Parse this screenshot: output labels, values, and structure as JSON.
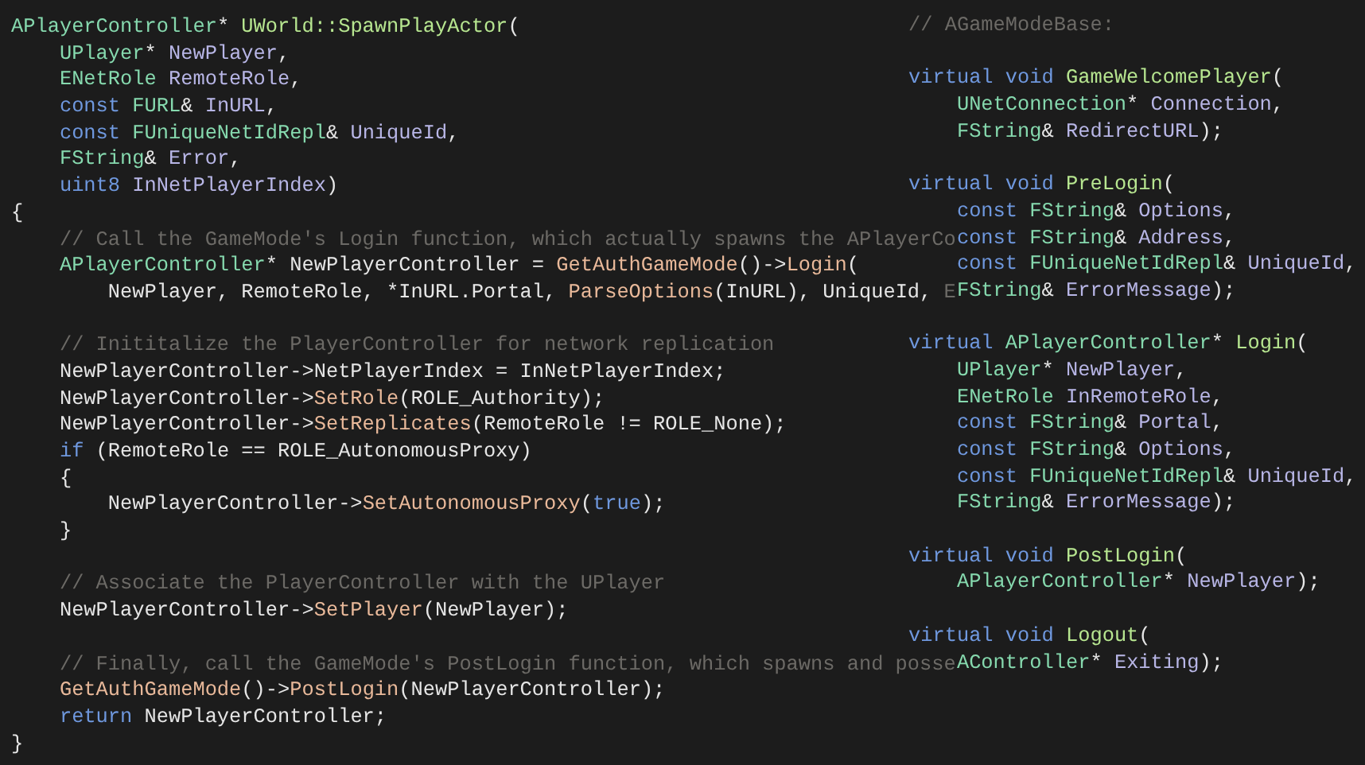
{
  "main_code": {
    "blocks": [
      {
        "lines": [
          [
            {
              "kind": "type",
              "text": "APlayerController"
            },
            {
              "kind": "plain",
              "text": "* "
            },
            {
              "kind": "func",
              "text": "UWorld::SpawnPlayActor"
            },
            {
              "kind": "plain",
              "text": "("
            }
          ],
          [
            {
              "kind": "type",
              "text": "    UPlayer"
            },
            {
              "kind": "plain",
              "text": "* "
            },
            {
              "kind": "param",
              "text": "NewPlayer"
            },
            {
              "kind": "plain",
              "text": ","
            }
          ],
          [
            {
              "kind": "type",
              "text": "    ENetRole "
            },
            {
              "kind": "param",
              "text": "RemoteRole"
            },
            {
              "kind": "plain",
              "text": ","
            }
          ],
          [
            {
              "kind": "keyword",
              "text": "    const "
            },
            {
              "kind": "type",
              "text": "FURL"
            },
            {
              "kind": "plain",
              "text": "& "
            },
            {
              "kind": "param",
              "text": "InURL"
            },
            {
              "kind": "plain",
              "text": ","
            }
          ],
          [
            {
              "kind": "keyword",
              "text": "    const "
            },
            {
              "kind": "type",
              "text": "FUniqueNetIdRepl"
            },
            {
              "kind": "plain",
              "text": "& "
            },
            {
              "kind": "param",
              "text": "UniqueId"
            },
            {
              "kind": "plain",
              "text": ","
            }
          ],
          [
            {
              "kind": "type",
              "text": "    FString"
            },
            {
              "kind": "plain",
              "text": "& "
            },
            {
              "kind": "param",
              "text": "Error"
            },
            {
              "kind": "plain",
              "text": ","
            }
          ],
          [
            {
              "kind": "keyword",
              "text": "    uint8 "
            },
            {
              "kind": "param",
              "text": "InNetPlayerIndex"
            },
            {
              "kind": "plain",
              "text": ")"
            }
          ],
          [
            {
              "kind": "plain",
              "text": "{"
            }
          ],
          [
            {
              "kind": "comment",
              "text": "    // Call the GameMode's Login function, which actually spawns the APlayerCo"
            }
          ],
          [
            {
              "kind": "type",
              "text": "    APlayerController"
            },
            {
              "kind": "plain",
              "text": "* NewPlayerController = "
            },
            {
              "kind": "call",
              "text": "GetAuthGameMode"
            },
            {
              "kind": "plain",
              "text": "()->"
            },
            {
              "kind": "call",
              "text": "Login"
            },
            {
              "kind": "plain",
              "text": "("
            }
          ],
          [
            {
              "kind": "plain",
              "text": "        NewPlayer, RemoteRole, *InURL.Portal, "
            },
            {
              "kind": "call",
              "text": "ParseOptions"
            },
            {
              "kind": "plain",
              "text": "(InURL), UniqueId, "
            },
            {
              "kind": "comment",
              "text": "E"
            }
          ]
        ]
      },
      {
        "lines": [
          [
            {
              "kind": "comment",
              "text": "    // Inititalize the PlayerController for network replication"
            }
          ],
          [
            {
              "kind": "plain",
              "text": "    NewPlayerController->NetPlayerIndex = InNetPlayerIndex;"
            }
          ],
          [
            {
              "kind": "plain",
              "text": "    NewPlayerController->"
            },
            {
              "kind": "call",
              "text": "SetRole"
            },
            {
              "kind": "plain",
              "text": "(ROLE_Authority);"
            }
          ],
          [
            {
              "kind": "plain",
              "text": "    NewPlayerController->"
            },
            {
              "kind": "call",
              "text": "SetReplicates"
            },
            {
              "kind": "plain",
              "text": "(RemoteRole != ROLE_None);"
            }
          ],
          [
            {
              "kind": "keyword",
              "text": "    if"
            },
            {
              "kind": "plain",
              "text": " (RemoteRole == ROLE_AutonomousProxy)"
            }
          ],
          [
            {
              "kind": "plain",
              "text": "    {"
            }
          ],
          [
            {
              "kind": "plain",
              "text": "        NewPlayerController->"
            },
            {
              "kind": "call",
              "text": "SetAutonomousProxy"
            },
            {
              "kind": "plain",
              "text": "("
            },
            {
              "kind": "keyword",
              "text": "true"
            },
            {
              "kind": "plain",
              "text": ");"
            }
          ],
          [
            {
              "kind": "plain",
              "text": "    }"
            }
          ]
        ]
      },
      {
        "lines": [
          [
            {
              "kind": "comment",
              "text": "    // Associate the PlayerController with the UPlayer"
            }
          ],
          [
            {
              "kind": "plain",
              "text": "    NewPlayerController->"
            },
            {
              "kind": "call",
              "text": "SetPlayer"
            },
            {
              "kind": "plain",
              "text": "(NewPlayer);"
            }
          ]
        ]
      },
      {
        "lines": [
          [
            {
              "kind": "comment",
              "text": "    // Finally, call the GameMode's PostLogin function, which spawns and posse"
            }
          ],
          [
            {
              "kind": "call",
              "text": "    GetAuthGameMode"
            },
            {
              "kind": "plain",
              "text": "()->"
            },
            {
              "kind": "call",
              "text": "PostLogin"
            },
            {
              "kind": "plain",
              "text": "(NewPlayerController);"
            }
          ],
          [
            {
              "kind": "keyword",
              "text": "    return"
            },
            {
              "kind": "plain",
              "text": " NewPlayerController;"
            }
          ],
          [
            {
              "kind": "plain",
              "text": "}"
            }
          ]
        ]
      }
    ]
  },
  "side_code": {
    "blocks": [
      {
        "lines": [
          [
            {
              "kind": "comment",
              "text": "// AGameModeBase:"
            }
          ]
        ]
      },
      {
        "lines": [
          [
            {
              "kind": "keyword",
              "text": "virtual void "
            },
            {
              "kind": "func",
              "text": "GameWelcomePlayer"
            },
            {
              "kind": "plain",
              "text": "("
            }
          ]
        ],
        "children": [
          [
            {
              "kind": "type",
              "text": "UNetConnection"
            },
            {
              "kind": "plain",
              "text": "* "
            },
            {
              "kind": "param",
              "text": "Connection"
            },
            {
              "kind": "plain",
              "text": ","
            }
          ],
          [
            {
              "kind": "type",
              "text": "FString"
            },
            {
              "kind": "plain",
              "text": "& "
            },
            {
              "kind": "param",
              "text": "RedirectURL"
            },
            {
              "kind": "plain",
              "text": ");"
            }
          ]
        ]
      },
      {
        "lines": [
          [
            {
              "kind": "keyword",
              "text": "virtual void "
            },
            {
              "kind": "func",
              "text": "PreLogin"
            },
            {
              "kind": "plain",
              "text": "("
            }
          ]
        ],
        "children": [
          [
            {
              "kind": "keyword",
              "text": "const "
            },
            {
              "kind": "type",
              "text": "FString"
            },
            {
              "kind": "plain",
              "text": "& "
            },
            {
              "kind": "param",
              "text": "Options"
            },
            {
              "kind": "plain",
              "text": ","
            }
          ],
          [
            {
              "kind": "keyword",
              "text": "const "
            },
            {
              "kind": "type",
              "text": "FString"
            },
            {
              "kind": "plain",
              "text": "& "
            },
            {
              "kind": "param",
              "text": "Address"
            },
            {
              "kind": "plain",
              "text": ","
            }
          ],
          [
            {
              "kind": "keyword",
              "text": "const "
            },
            {
              "kind": "type",
              "text": "FUniqueNetIdRepl"
            },
            {
              "kind": "plain",
              "text": "& "
            },
            {
              "kind": "param",
              "text": "UniqueId"
            },
            {
              "kind": "plain",
              "text": ","
            }
          ],
          [
            {
              "kind": "type",
              "text": "FString"
            },
            {
              "kind": "plain",
              "text": "& "
            },
            {
              "kind": "param",
              "text": "ErrorMessage"
            },
            {
              "kind": "plain",
              "text": ");"
            }
          ]
        ]
      },
      {
        "lines": [
          [
            {
              "kind": "keyword",
              "text": "virtual "
            },
            {
              "kind": "type",
              "text": "APlayerController"
            },
            {
              "kind": "plain",
              "text": "* "
            },
            {
              "kind": "func",
              "text": "Login"
            },
            {
              "kind": "plain",
              "text": "("
            }
          ]
        ],
        "children": [
          [
            {
              "kind": "type",
              "text": "UPlayer"
            },
            {
              "kind": "plain",
              "text": "* "
            },
            {
              "kind": "param",
              "text": "NewPlayer"
            },
            {
              "kind": "plain",
              "text": ","
            }
          ],
          [
            {
              "kind": "type",
              "text": "ENetRole "
            },
            {
              "kind": "param",
              "text": "InRemoteRole"
            },
            {
              "kind": "plain",
              "text": ","
            }
          ],
          [
            {
              "kind": "keyword",
              "text": "const "
            },
            {
              "kind": "type",
              "text": "FString"
            },
            {
              "kind": "plain",
              "text": "& "
            },
            {
              "kind": "param",
              "text": "Portal"
            },
            {
              "kind": "plain",
              "text": ","
            }
          ],
          [
            {
              "kind": "keyword",
              "text": "const "
            },
            {
              "kind": "type",
              "text": "FString"
            },
            {
              "kind": "plain",
              "text": "& "
            },
            {
              "kind": "param",
              "text": "Options"
            },
            {
              "kind": "plain",
              "text": ","
            }
          ],
          [
            {
              "kind": "keyword",
              "text": "const "
            },
            {
              "kind": "type",
              "text": "FUniqueNetIdRepl"
            },
            {
              "kind": "plain",
              "text": "& "
            },
            {
              "kind": "param",
              "text": "UniqueId"
            },
            {
              "kind": "plain",
              "text": ","
            }
          ],
          [
            {
              "kind": "type",
              "text": "FString"
            },
            {
              "kind": "plain",
              "text": "& "
            },
            {
              "kind": "param",
              "text": "ErrorMessage"
            },
            {
              "kind": "plain",
              "text": ");"
            }
          ]
        ]
      },
      {
        "lines": [
          [
            {
              "kind": "keyword",
              "text": "virtual void "
            },
            {
              "kind": "func",
              "text": "PostLogin"
            },
            {
              "kind": "plain",
              "text": "("
            }
          ]
        ],
        "children": [
          [
            {
              "kind": "type",
              "text": "APlayerController"
            },
            {
              "kind": "plain",
              "text": "* "
            },
            {
              "kind": "param",
              "text": "NewPlayer"
            },
            {
              "kind": "plain",
              "text": ");"
            }
          ]
        ]
      },
      {
        "lines": [
          [
            {
              "kind": "keyword",
              "text": "virtual void "
            },
            {
              "kind": "func",
              "text": "Logout"
            },
            {
              "kind": "plain",
              "text": "("
            }
          ]
        ],
        "children": [
          [
            {
              "kind": "type",
              "text": "AController"
            },
            {
              "kind": "plain",
              "text": "* "
            },
            {
              "kind": "param",
              "text": "Exiting"
            },
            {
              "kind": "plain",
              "text": ");"
            }
          ]
        ]
      }
    ]
  }
}
